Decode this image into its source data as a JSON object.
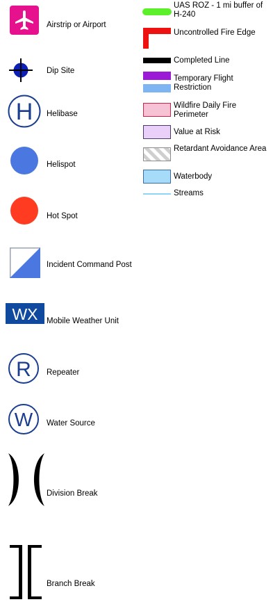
{
  "left_column": {
    "airstrip": "Airstrip or Airport",
    "dip_site": "Dip Site",
    "helibase": "Helibase",
    "helibase_symbol": "H",
    "helispot": "Helispot",
    "hot_spot": "Hot Spot",
    "icp": "Incident Command Post",
    "weather": "Mobile Weather Unit",
    "weather_symbol": "WX",
    "repeater": "Repeater",
    "repeater_symbol": "R",
    "water_source": "Water Source",
    "water_symbol": "W",
    "division_break": "Division Break",
    "branch_break": "Branch Break"
  },
  "right_column": {
    "uas_roz": "UAS ROZ - 1 mi buffer of H-240",
    "uncontrolled_edge": "Uncontrolled Fire Edge",
    "completed_line": "Completed Line",
    "tfr": "Temporary Flight Restriction",
    "perimeter": "Wildfire Daily Fire Perimeter",
    "value_at_risk": "Value at Risk",
    "retardant": "Retardant Avoidance Area",
    "waterbody": "Waterbody",
    "streams": "Streams"
  },
  "colors": {
    "airstrip": "#e6118c",
    "dip_site": "#0d1fb5",
    "helibase": "#1a3d8f",
    "helispot": "#4a78e0",
    "hot_spot": "#ff3b22",
    "icp": "#4a78e0",
    "weather_bg": "#0f4a9e",
    "repeater": "#1a3d8f",
    "water_source": "#1a3d8f",
    "uas_roz": "#5cf02a",
    "uncontrolled_edge": "#ee1111",
    "completed_line": "#000000",
    "tfr_purple": "#9a1ad6",
    "tfr_blue": "#7fb4f2",
    "perimeter_fill": "#f5c3d3",
    "perimeter_border": "#c4264c",
    "value_fill": "#ead0f8",
    "value_border": "#4a3a66",
    "retardant_fill": "#e6e6e6",
    "waterbody_fill": "#a6dcf7",
    "waterbody_border": "#3d6b9e",
    "streams": "#8fd5f5"
  },
  "icons": {
    "airstrip": "airplane-icon",
    "dip_site": "crosshair-circle-icon",
    "helibase": "circled-h-icon",
    "helispot": "filled-circle-icon",
    "hot_spot": "filled-circle-icon",
    "icp": "split-square-icon",
    "weather": "wx-box-icon",
    "repeater": "circled-r-icon",
    "water_source": "circled-w-icon",
    "division_break": "parentheses-icon",
    "branch_break": "double-bracket-icon"
  }
}
